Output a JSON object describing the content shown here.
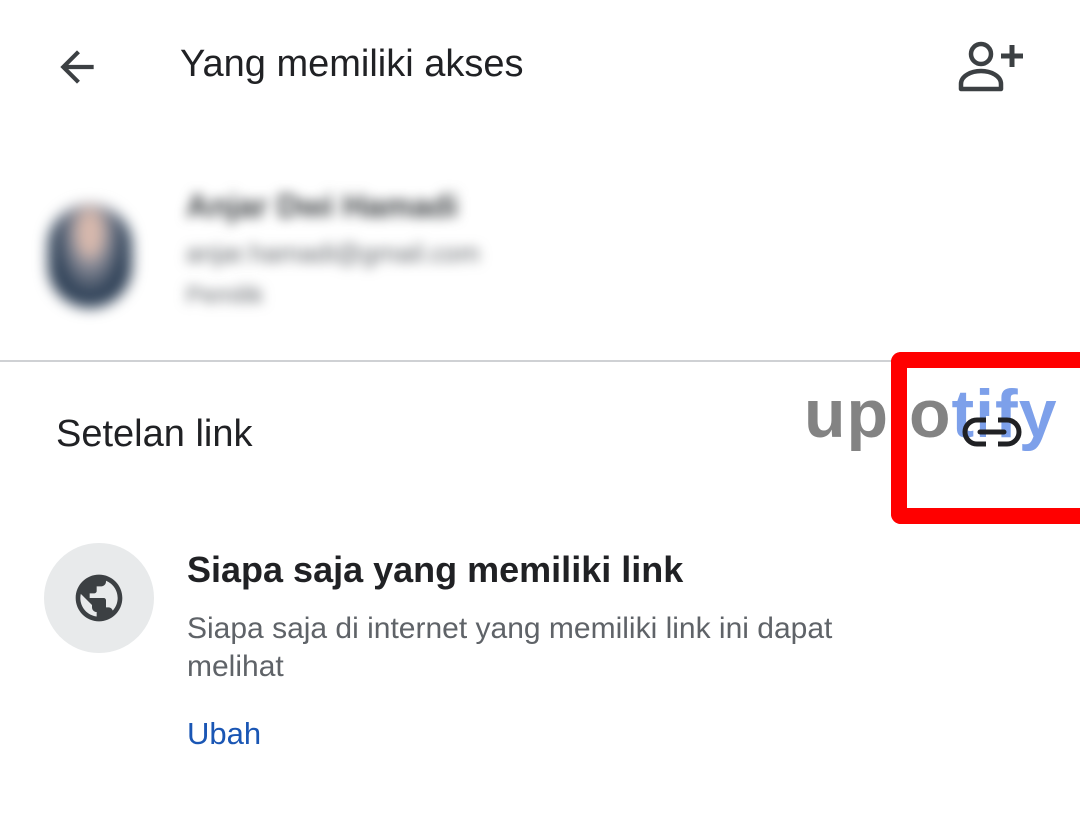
{
  "header": {
    "title": "Yang memiliki akses",
    "back_icon": "arrow-back-icon",
    "add_person_icon": "person-add-icon"
  },
  "user": {
    "name": "Anjar Dwi Hamadi",
    "email": "anjar.hamadi@gmail.com",
    "role": "Pemilik"
  },
  "link_settings": {
    "title": "Setelan link",
    "link_icon": "link-icon",
    "highlight_color": "#ff0000"
  },
  "access": {
    "icon": "globe-icon",
    "title": "Siapa saja yang memiliki link",
    "description": "Siapa saja di internet yang memiliki link ini dapat melihat",
    "change_label": "Ubah",
    "link_color": "#1a56b4"
  },
  "watermark": {
    "part1": "uplo",
    "part2": "tify"
  }
}
